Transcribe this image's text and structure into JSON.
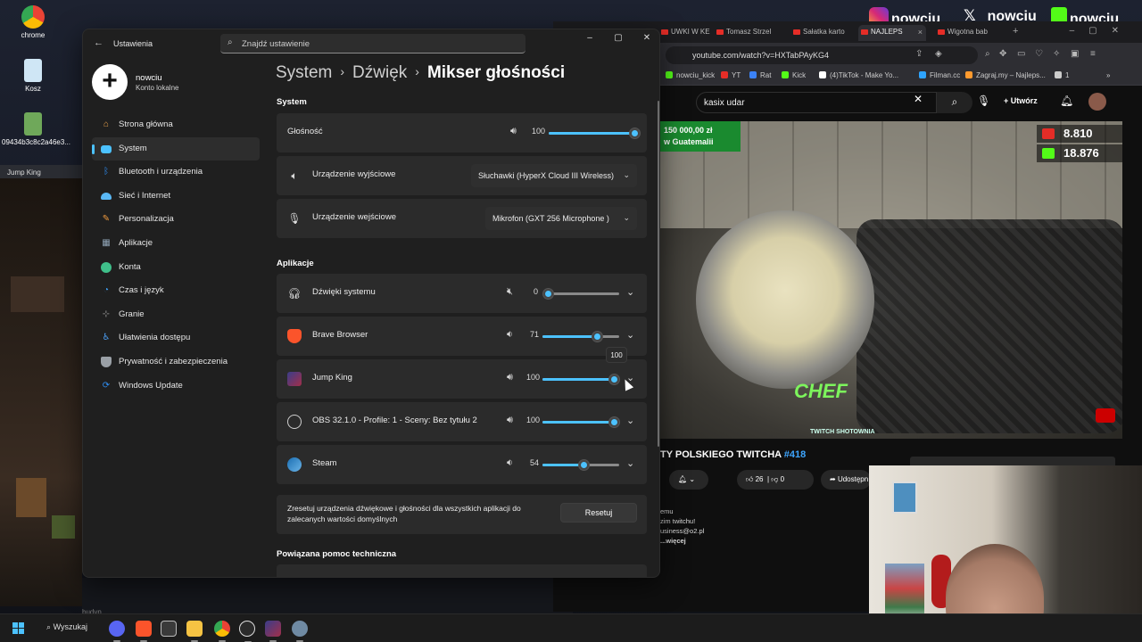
{
  "desktop": {
    "icons": [
      {
        "label": "chrome",
        "icon": "chrome-icon"
      },
      {
        "label": "Kosz",
        "icon": "recycle-bin-icon"
      },
      {
        "label": "09434b3c8c2a46e3...",
        "icon": "image-file-icon"
      }
    ],
    "side_window_tab": "Jump King",
    "partial_text_bottom": "budyn"
  },
  "social_overlay": {
    "instagram": "nowciu_",
    "x": "_nowciu",
    "kick": "nowciu"
  },
  "browser": {
    "tabs": [
      {
        "label": "UWKI W KE",
        "active": false
      },
      {
        "label": "Tomasz Strzel",
        "active": false
      },
      {
        "label": "Sałatka karto",
        "active": false
      },
      {
        "label": "NAJLEPS",
        "active": true
      },
      {
        "label": "Wigotna bab",
        "active": false
      }
    ],
    "url": "youtube.com/watch?v=HXTabPAyKG4",
    "bookmarks": [
      {
        "label": "nowciu_kick",
        "color": "#53fc18"
      },
      {
        "label": "YT",
        "color": "#e52d27"
      },
      {
        "label": "Rat",
        "color": "#3b82f6"
      },
      {
        "label": "Kick",
        "color": "#53fc18"
      },
      {
        "label": "(4)TikTok - Make Yo...",
        "color": "#ffffff"
      },
      {
        "label": "Filman.cc",
        "color": "#2ea4ff"
      },
      {
        "label": "Zagraj.my – Najleps...",
        "color": "#ff9a2e"
      },
      {
        "label": "1",
        "color": "#cccccc"
      }
    ],
    "youtube": {
      "search_query": "kasix udar",
      "create_label": "Utwórz",
      "video": {
        "banner_line1": "150 000,00 zł",
        "banner_line2": "w Guatemalii",
        "stat_youtube": "8.810",
        "stat_kick": "18.876",
        "overlay_logo": "CHEF",
        "overlay_sub": "TWITCH SHOTOWNIA"
      },
      "title_text": "TY POLSKIEGO TWITCHA",
      "title_tag": "#418",
      "likes": "26",
      "dislikes": "0",
      "share_label": "Udostępn",
      "description_lines": [
        "emu",
        "zim twitchu!",
        "usiness@o2.pl"
      ],
      "more_label": "...więcej"
    }
  },
  "settings": {
    "app_title": "Ustawienia",
    "search_placeholder": "Znajdź ustawienie",
    "user": {
      "name": "nowciu",
      "type": "Konto lokalne"
    },
    "nav": [
      {
        "label": "Strona główna",
        "icon": "home-icon",
        "color": "#e8a04a",
        "active": false
      },
      {
        "label": "System",
        "icon": "system-icon",
        "color": "#4cc2ff",
        "active": true
      },
      {
        "label": "Bluetooth i urządzenia",
        "icon": "bluetooth-icon",
        "color": "#2e8cf0",
        "active": false
      },
      {
        "label": "Sieć i Internet",
        "icon": "wifi-icon",
        "color": "#5ab8f5",
        "active": false
      },
      {
        "label": "Personalizacja",
        "icon": "brush-icon",
        "color": "#f09a3e",
        "active": false
      },
      {
        "label": "Aplikacje",
        "icon": "apps-icon",
        "color": "#8fa3b5",
        "active": false
      },
      {
        "label": "Konta",
        "icon": "account-icon",
        "color": "#3fbf8a",
        "active": false
      },
      {
        "label": "Czas i język",
        "icon": "clock-globe-icon",
        "color": "#3e9cf0",
        "active": false
      },
      {
        "label": "Granie",
        "icon": "gamepad-icon",
        "color": "#a0a0a0",
        "active": false
      },
      {
        "label": "Ułatwienia dostępu",
        "icon": "accessibility-icon",
        "color": "#4c9ff5",
        "active": false
      },
      {
        "label": "Prywatność i zabezpieczenia",
        "icon": "shield-icon",
        "color": "#9aa0a6",
        "active": false
      },
      {
        "label": "Windows Update",
        "icon": "update-icon",
        "color": "#2e8cf0",
        "active": false
      }
    ],
    "breadcrumb": [
      "System",
      "Dźwięk",
      "Mikser głośności"
    ],
    "section_system": "System",
    "master_volume": {
      "label": "Głośność",
      "value": 100
    },
    "output_device": {
      "label": "Urządzenie wyjściowe",
      "selected": "Słuchawki (HyperX Cloud III Wireless)"
    },
    "input_device": {
      "label": "Urządzenie wejściowe",
      "selected": "Mikrofon (GXT 256 Microphone )"
    },
    "section_apps": "Aplikacje",
    "apps": [
      {
        "name": "Dźwięki systemu",
        "icon": "headphones-icon",
        "volume": 0,
        "muted_icon": true
      },
      {
        "name": "Brave Browser",
        "icon": "brave-icon",
        "volume": 71,
        "muted_icon": false
      },
      {
        "name": "Jump King",
        "icon": "jump-king-icon",
        "volume": 100,
        "muted_icon": false
      },
      {
        "name": "OBS 32.1.0 - Profile: 1 - Sceny: Bez tytułu 2",
        "icon": "obs-icon",
        "volume": 100,
        "muted_icon": false
      },
      {
        "name": "Steam",
        "icon": "steam-icon",
        "volume": 54,
        "muted_icon": false
      }
    ],
    "slider_tooltip": "100",
    "reset_text": "Zresetuj urządzenia dźwiękowe i głośności dla wszystkich aplikacji do zalecanych wartości domyślnych",
    "reset_button": "Resetuj",
    "help_title": "Powiązana pomoc techniczna"
  },
  "taskbar": {
    "search_label": "Wyszukaj",
    "apps": [
      "discord-icon",
      "brave-icon",
      "media-icon",
      "file-explorer-icon",
      "chrome-icon",
      "obs-icon",
      "app-icon",
      "settings-icon"
    ]
  },
  "colors": {
    "accent": "#4cc2ff",
    "settings_bg": "#1f1f1f",
    "card_bg": "#2b2b2b"
  }
}
